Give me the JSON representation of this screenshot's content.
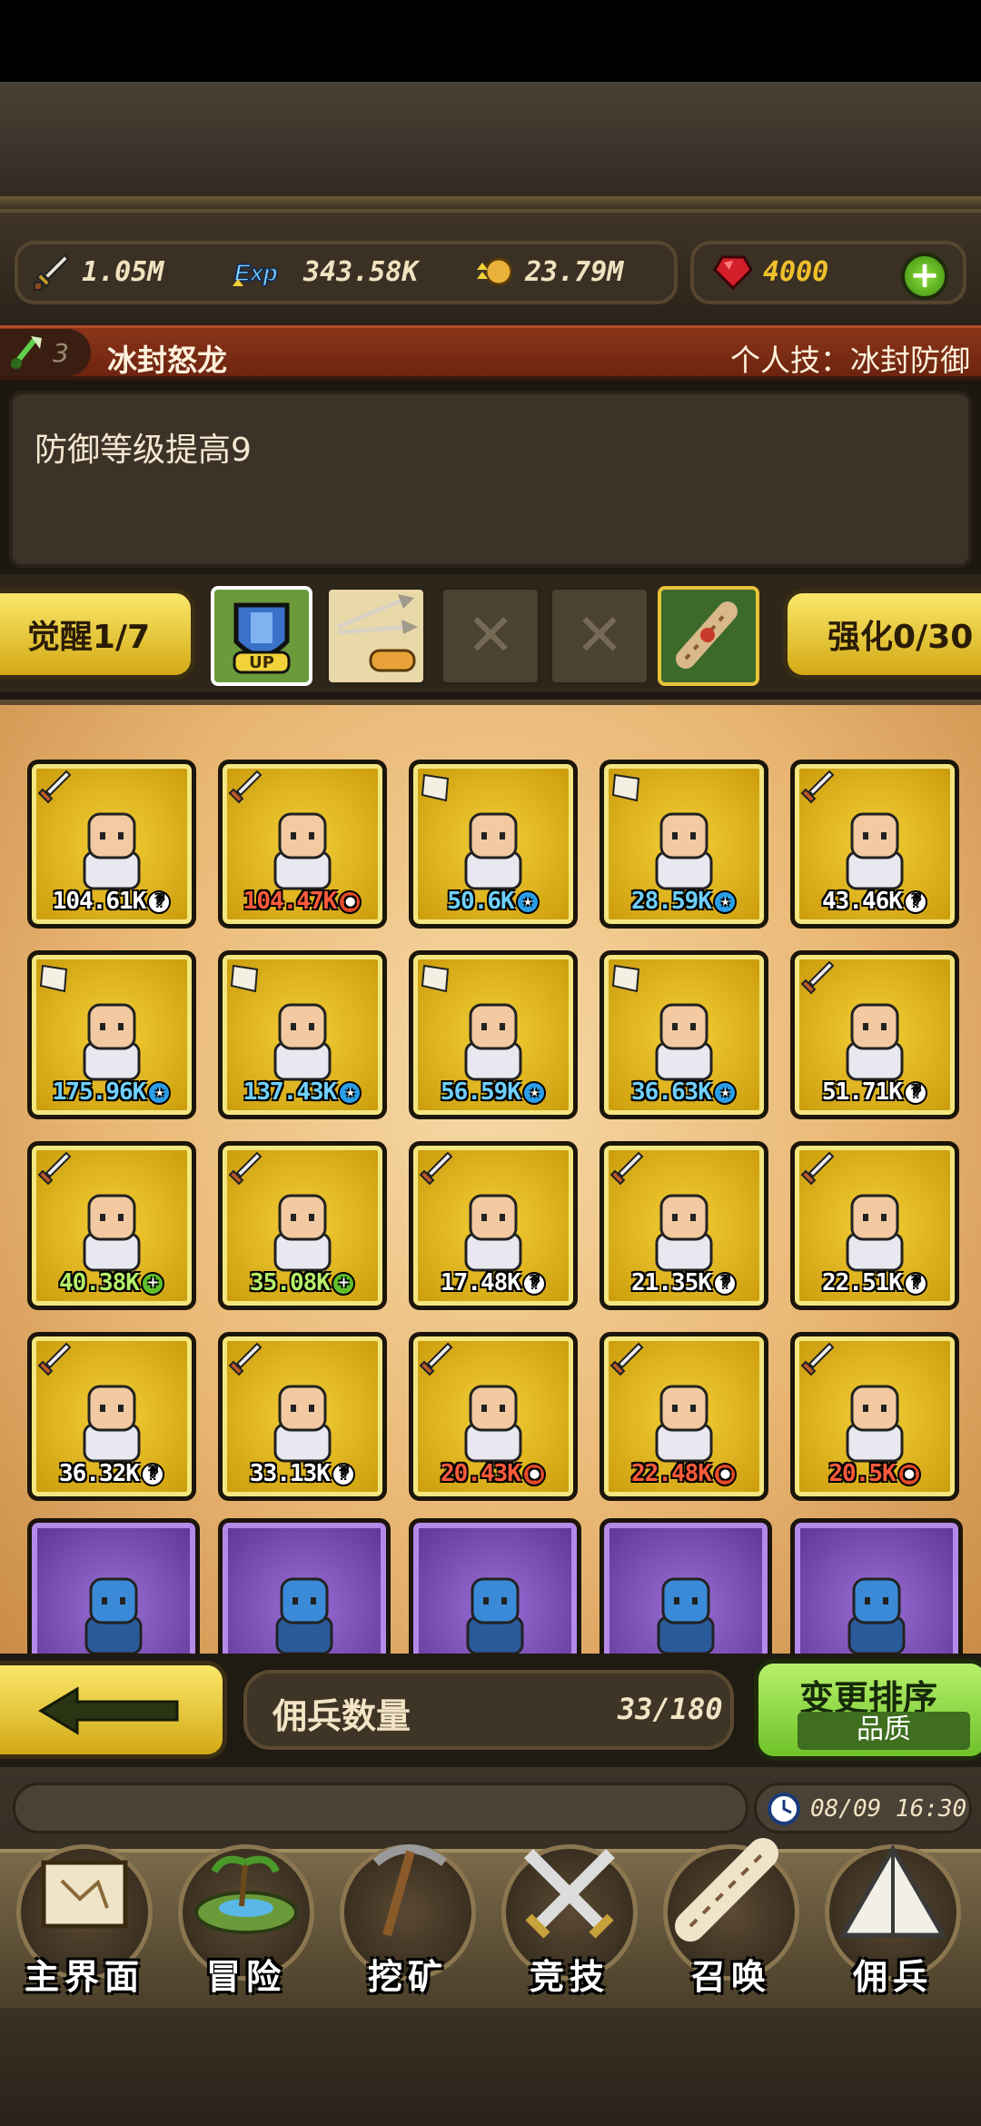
{
  "resources": {
    "gold": "1.05M",
    "exp_label": "Exp",
    "exp": "343.58K",
    "coins": "23.79M",
    "gems": "4000"
  },
  "skill": {
    "level": "3",
    "name": "冰封怒龙",
    "personal": "个人技：冰封防御",
    "description": "防御等级提高9"
  },
  "gear": {
    "awaken_label": "觉醒1/7",
    "upgrade_label": "强化0/30",
    "up_text": "UP",
    "empty_mark": "✕"
  },
  "mercenaries": [
    {
      "power": "104.61K",
      "color": "white",
      "elem": "?",
      "elem_color": "white",
      "weapon": "sword",
      "rarity": "gold"
    },
    {
      "power": "104.47K",
      "color": "red",
      "elem": "●",
      "elem_color": "red",
      "weapon": "sword",
      "rarity": "gold"
    },
    {
      "power": "50.6K",
      "color": "blue",
      "elem": "★",
      "elem_color": "blue",
      "weapon": "shield",
      "rarity": "gold"
    },
    {
      "power": "28.59K",
      "color": "blue",
      "elem": "★",
      "elem_color": "blue",
      "weapon": "shield",
      "rarity": "gold"
    },
    {
      "power": "43.46K",
      "color": "white",
      "elem": "?",
      "elem_color": "white",
      "weapon": "sword",
      "rarity": "gold"
    },
    {
      "power": "175.96K",
      "color": "blue",
      "elem": "★",
      "elem_color": "blue",
      "weapon": "shield",
      "rarity": "gold"
    },
    {
      "power": "137.43K",
      "color": "blue",
      "elem": "★",
      "elem_color": "blue",
      "weapon": "shield",
      "rarity": "gold"
    },
    {
      "power": "56.59K",
      "color": "blue",
      "elem": "★",
      "elem_color": "blue",
      "weapon": "shield",
      "rarity": "gold"
    },
    {
      "power": "36.63K",
      "color": "blue",
      "elem": "★",
      "elem_color": "blue",
      "weapon": "shield",
      "rarity": "gold"
    },
    {
      "power": "51.71K",
      "color": "white",
      "elem": "?",
      "elem_color": "white",
      "weapon": "sword",
      "rarity": "gold"
    },
    {
      "power": "40.38K",
      "color": "green",
      "elem": "+",
      "elem_color": "green",
      "weapon": "sword",
      "rarity": "gold"
    },
    {
      "power": "35.08K",
      "color": "green",
      "elem": "+",
      "elem_color": "green",
      "weapon": "sword",
      "rarity": "gold"
    },
    {
      "power": "17.48K",
      "color": "white",
      "elem": "?",
      "elem_color": "white",
      "weapon": "sword",
      "rarity": "gold"
    },
    {
      "power": "21.35K",
      "color": "white",
      "elem": "?",
      "elem_color": "white",
      "weapon": "sword",
      "rarity": "gold"
    },
    {
      "power": "22.51K",
      "color": "white",
      "elem": "?",
      "elem_color": "white",
      "weapon": "sword",
      "rarity": "gold"
    },
    {
      "power": "36.32K",
      "color": "white",
      "elem": "?",
      "elem_color": "white",
      "weapon": "sword",
      "rarity": "gold"
    },
    {
      "power": "33.13K",
      "color": "white",
      "elem": "?",
      "elem_color": "white",
      "weapon": "sword",
      "rarity": "gold"
    },
    {
      "power": "20.43K",
      "color": "red",
      "elem": "●",
      "elem_color": "red",
      "weapon": "sword",
      "rarity": "gold"
    },
    {
      "power": "22.48K",
      "color": "red",
      "elem": "●",
      "elem_color": "red",
      "weapon": "sword",
      "rarity": "gold"
    },
    {
      "power": "20.5K",
      "color": "red",
      "elem": "●",
      "elem_color": "red",
      "weapon": "sword",
      "rarity": "gold"
    },
    {
      "power": "",
      "color": "white",
      "elem": "",
      "elem_color": "white",
      "weapon": "",
      "rarity": "epic"
    },
    {
      "power": "",
      "color": "white",
      "elem": "",
      "elem_color": "white",
      "weapon": "",
      "rarity": "epic"
    },
    {
      "power": "",
      "color": "white",
      "elem": "",
      "elem_color": "white",
      "weapon": "",
      "rarity": "epic"
    },
    {
      "power": "",
      "color": "white",
      "elem": "",
      "elem_color": "white",
      "weapon": "",
      "rarity": "epic"
    },
    {
      "power": "",
      "color": "white",
      "elem": "",
      "elem_color": "white",
      "weapon": "",
      "rarity": "epic"
    }
  ],
  "footer": {
    "count_label": "佣兵数量",
    "count_value": "33/180",
    "sort_title": "变更排序",
    "sort_mode": "品质"
  },
  "status": {
    "datetime": "08/09 16:30"
  },
  "nav": [
    {
      "label": "主界面",
      "icon": "scroll-map-icon"
    },
    {
      "label": "冒险",
      "icon": "island-icon"
    },
    {
      "label": "挖矿",
      "icon": "pickaxe-icon"
    },
    {
      "label": "竞技",
      "icon": "crossed-swords-icon"
    },
    {
      "label": "召唤",
      "icon": "summon-scroll-icon"
    },
    {
      "label": "佣兵",
      "icon": "tent-icon"
    }
  ],
  "colors": {
    "gold_button": "#f0d43a",
    "green_button": "#8fd846",
    "skill_bar": "#7a2a12",
    "card_gold": "#e3b61d",
    "card_epic": "#7b4cb5"
  }
}
